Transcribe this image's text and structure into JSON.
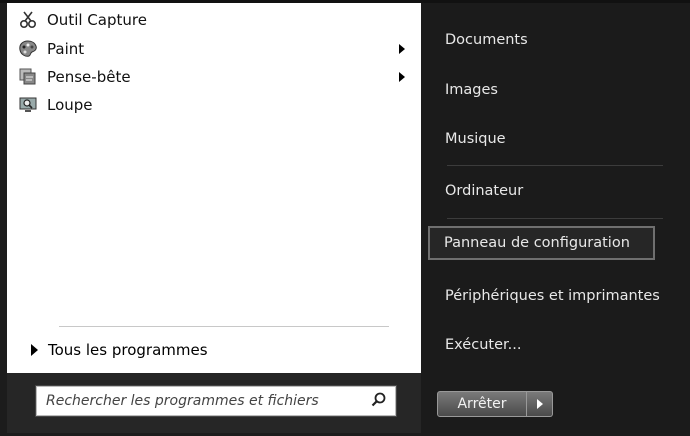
{
  "programs": [
    {
      "label": "Outil Capture",
      "icon": "scissors-icon",
      "has_submenu": false
    },
    {
      "label": "Paint",
      "icon": "palette-icon",
      "has_submenu": true
    },
    {
      "label": "Pense-bête",
      "icon": "sticky-notes-icon",
      "has_submenu": true
    },
    {
      "label": "Loupe",
      "icon": "magnifier-monitor-icon",
      "has_submenu": false
    }
  ],
  "all_programs_label": "Tous les programmes",
  "search": {
    "placeholder": "Rechercher les programmes et fichiers",
    "icon": "search-icon"
  },
  "right_items": [
    {
      "label": "Documents"
    },
    {
      "label": "Images"
    },
    {
      "label": "Musique"
    },
    {
      "label": "Ordinateur"
    },
    {
      "label": "Panneau de configuration",
      "highlighted": true
    },
    {
      "label": "Périphériques et imprimantes"
    },
    {
      "label": "Exécuter..."
    }
  ],
  "shutdown": {
    "label": "Arrêter",
    "arrow_icon": "chevron-right-icon"
  },
  "colors": {
    "left_bg": "#ffffff",
    "right_bg": "#1b1b1b",
    "highlight_border": "#6f6f6f"
  }
}
